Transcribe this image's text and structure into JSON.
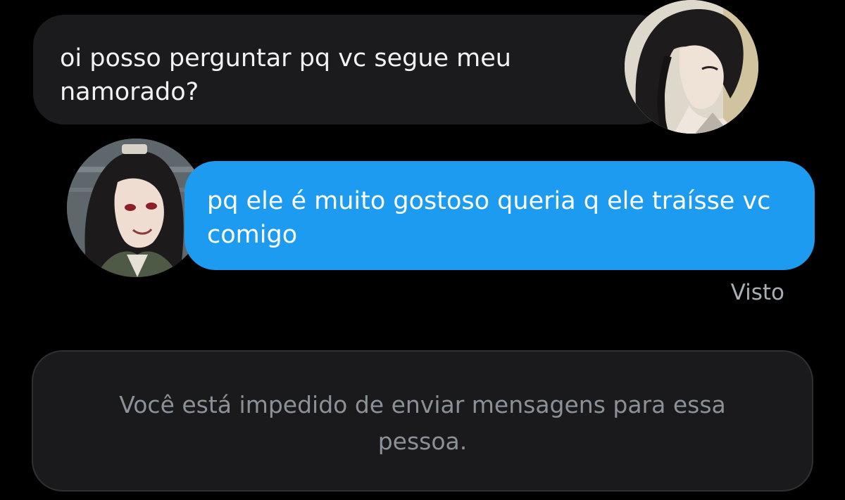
{
  "conversation": {
    "messages": [
      {
        "direction": "received",
        "text": "oi posso perguntar pq vc segue meu namorado?",
        "avatar_icon": "user-avatar-icon"
      },
      {
        "direction": "sent",
        "text": "pq ele é muito gostoso queria q ele traísse vc comigo",
        "avatar_icon": "user-avatar-icon"
      }
    ],
    "status": "Visto"
  },
  "composer": {
    "blocked_notice": "Você está impedido de enviar mensagens para essa pessoa."
  },
  "colors": {
    "background": "#000000",
    "received_bubble": "#1b1b1d",
    "sent_bubble": "#1d9bf0",
    "status_text": "#a7aeb5",
    "notice_text": "#8b9197"
  }
}
